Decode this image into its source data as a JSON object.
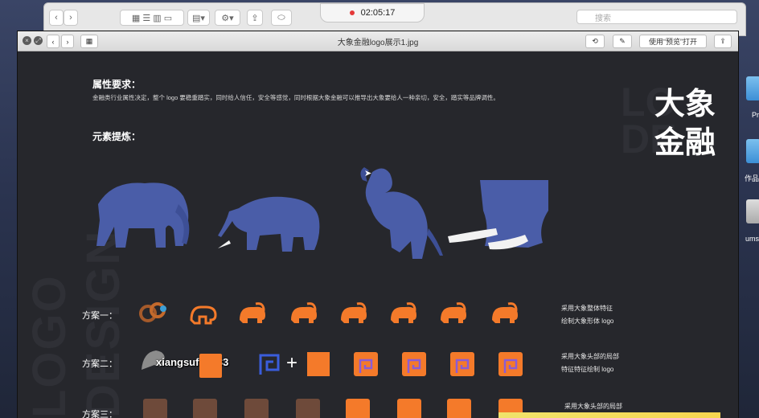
{
  "timer": {
    "elapsed": "02:05:17"
  },
  "finder": {
    "search_placeholder": "搜索"
  },
  "desktop": {
    "labels": [
      "Pr",
      "作品",
      "ums"
    ]
  },
  "quicklook": {
    "title": "大象金融logo展示1.jpg",
    "open_with_label": "使用“预览”打开"
  },
  "board": {
    "attr_heading": "属性要求：",
    "attr_desc": "金融类行业属性决定，整个 logo 要稳重踏实，同时给人信任，安全等感觉，同时根据大象金融可以推导出大象要给人一种亲切，安全，踏实等品牌调性。",
    "element_heading": "元素提炼：",
    "brand_line1": "大象",
    "brand_line2": "金融",
    "watermark": "LOGO DESIGN",
    "rows": [
      {
        "label": "方案一：",
        "note1": "采用大象整体特征",
        "note2": "绘制大象形体 logo"
      },
      {
        "label": "方案二：",
        "note1": "采用大象头部的局部",
        "note2": "特征特征绘制 logo"
      },
      {
        "label": "方案三：",
        "note1": "采用大象头部的局部",
        "note2": ""
      }
    ],
    "username": "xiangsufan133",
    "plus": "+"
  },
  "colors": {
    "accent": "#f47a2a",
    "elephant": "#4a5da8",
    "bg": "#26272c"
  }
}
